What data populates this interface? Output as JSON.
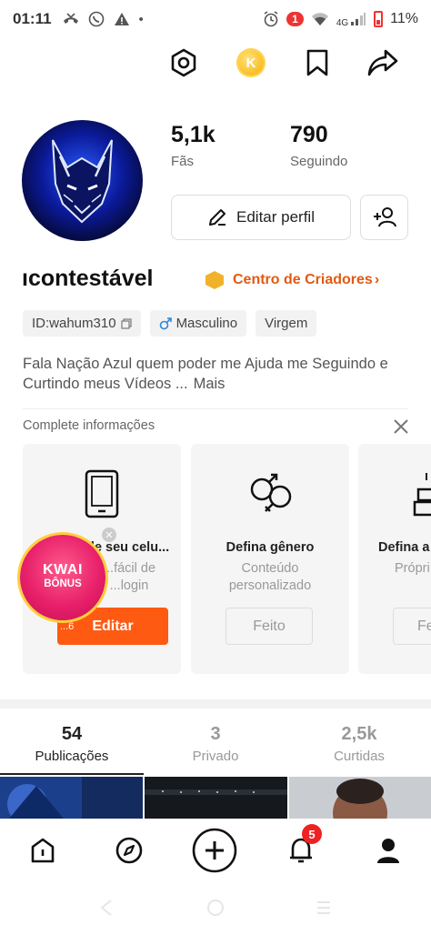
{
  "status_bar": {
    "time": "01:11",
    "notification_count": "1",
    "network": "4G",
    "battery": "11%"
  },
  "top_actions": {
    "coin_label": "K"
  },
  "profile": {
    "fans_count": "5,1k",
    "fans_label": "Fãs",
    "following_count": "790",
    "following_label": "Seguindo",
    "edit_button": "Editar perfil",
    "username": "ıcontestável",
    "creators_link": "Centro de Criadores",
    "creators_chevron": "›",
    "tags": {
      "id": "ID:wahum310",
      "gender": "Masculino",
      "sign": "Virgem"
    },
    "bio": "Fala Nação Azul quem poder me Ajuda me Seguindo e Curtindo meus Vídeos ...",
    "bio_more": "Mais"
  },
  "complete_info": {
    "title": "Complete informações",
    "cards": [
      {
        "title": "...le seu celu...",
        "desc_line1": "...fácil de",
        "desc_line2": "...login",
        "button": "Editar",
        "progress": "...6"
      },
      {
        "title": "Defina gênero",
        "desc_line1": "Conteúdo",
        "desc_line2": "personalizado",
        "button": "Feito"
      },
      {
        "title": "Defina a",
        "desc_line1": "Própri",
        "button": "Fe"
      }
    ]
  },
  "kwai_bonus": {
    "line1": "KWAI",
    "line2": "BÔNUS"
  },
  "tabs": [
    {
      "count": "54",
      "label": "Publicações"
    },
    {
      "count": "3",
      "label": "Privado"
    },
    {
      "count": "2,5k",
      "label": "Curtidas"
    }
  ],
  "bottom_nav": {
    "notifications_badge": "5"
  },
  "colors": {
    "accent_orange": "#ff5a12",
    "creator_orange": "#e05a12",
    "badge_red": "#e22222"
  }
}
